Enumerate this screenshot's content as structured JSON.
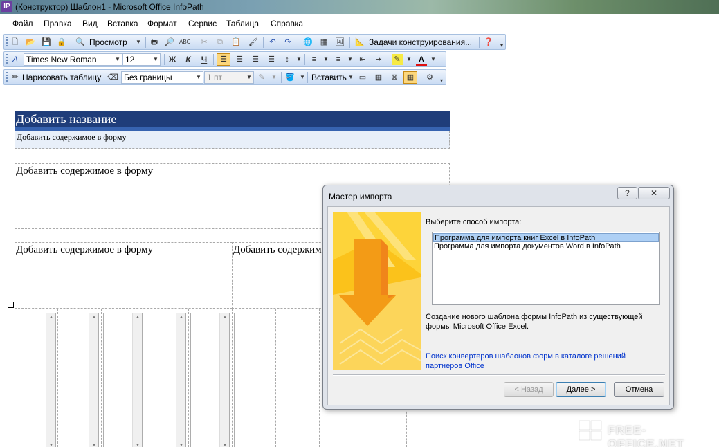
{
  "window": {
    "title": "(Конструктор) Шаблон1 - Microsoft Office InfoPath",
    "icon_letter": "IP"
  },
  "menu": [
    "Файл",
    "Правка",
    "Вид",
    "Вставка",
    "Формат",
    "Сервис",
    "Таблица",
    "Справка"
  ],
  "toolbar1": {
    "preview_label": "Просмотр",
    "design_tasks_label": "Задачи конструирования..."
  },
  "toolbar2": {
    "font": "Times New Roman",
    "size": "12",
    "bold": "Ж",
    "italic": "К",
    "underline": "Ч",
    "font_color_letter": "A"
  },
  "toolbar3": {
    "draw_table_label": "Нарисовать таблицу",
    "border_style": "Без границы",
    "border_width": "1 пт",
    "insert_label": "Вставить"
  },
  "form": {
    "title": "Добавить название",
    "subtitle": "Добавить содержимое в форму",
    "section1": "Добавить содержимое в форму",
    "section2_left": "Добавить содержимое в форму",
    "section2_right": "Добавить содержим"
  },
  "dialog": {
    "title": "Мастер импорта",
    "help_btn": "?",
    "close_btn": "✕",
    "prompt": "Выберите способ импорта:",
    "options": [
      "Программа для импорта книг Excel в InfoPath",
      "Программа для импорта документов Word в InfoPath"
    ],
    "selected_index": 0,
    "description": "Создание нового шаблона формы InfoPath из существующей формы Microsoft Office Excel.",
    "link": "Поиск конвертеров шаблонов форм в каталоге решений партнеров Office",
    "back_btn": "< Назад",
    "next_btn": "Далее >",
    "cancel_btn": "Отмена"
  },
  "watermark": "FREE-OFFICE.NET"
}
